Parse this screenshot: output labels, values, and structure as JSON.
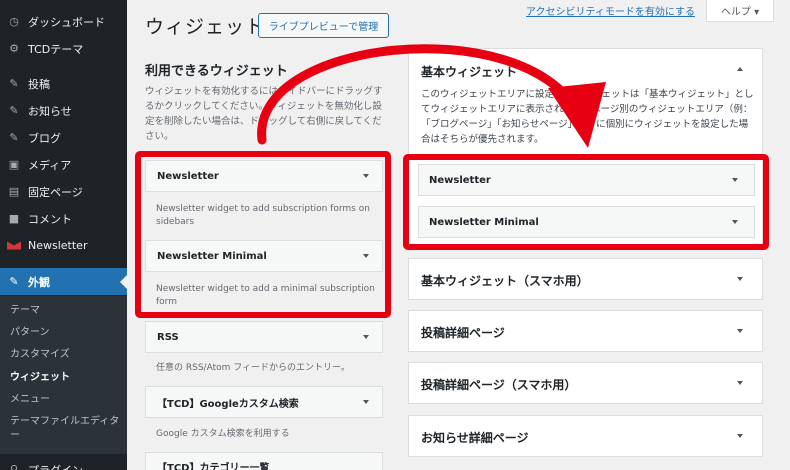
{
  "sidebar": {
    "items": [
      {
        "icon": "dashboard-icon",
        "glyph": "◷",
        "label": "ダッシュボード"
      },
      {
        "icon": "gear-icon",
        "glyph": "⚙",
        "label": "TCDテーマ"
      },
      {
        "icon": "pin-icon",
        "glyph": "✎",
        "label": "投稿"
      },
      {
        "icon": "pin-icon",
        "glyph": "✎",
        "label": "お知らせ"
      },
      {
        "icon": "pin-icon",
        "glyph": "✎",
        "label": "ブログ"
      },
      {
        "icon": "media-icon",
        "glyph": "▣",
        "label": "メディア"
      },
      {
        "icon": "page-icon",
        "glyph": "▤",
        "label": "固定ページ"
      },
      {
        "icon": "comment-icon",
        "glyph": "■",
        "label": "コメント"
      },
      {
        "icon": "newsletter-icon",
        "glyph": "",
        "label": "Newsletter"
      },
      {
        "icon": "appearance-icon",
        "glyph": "✎",
        "label": "外観"
      },
      {
        "icon": "plugin-icon",
        "glyph": "⚲",
        "label": "プラグイン"
      }
    ],
    "submenu": [
      "テーマ",
      "パターン",
      "カスタマイズ",
      "ウィジェット",
      "メニュー",
      "テーマファイルエディター"
    ]
  },
  "header": {
    "title": "ウィジェット",
    "preview_button": "ライブプレビューで管理",
    "accessibility_link": "アクセシビリティモードを有効にする",
    "help_tab": "ヘルプ ▾"
  },
  "available": {
    "title": "利用できるウィジェット",
    "description": "ウィジェットを有効化するにはサイドバーにドラッグするかクリックしてください。ウィジェットを無効化し設定を削除したい場合は、ドラッグして右側に戻してください。",
    "widgets": [
      {
        "name": "Newsletter",
        "desc": "Newsletter widget to add subscription forms on sidebars"
      },
      {
        "name": "Newsletter Minimal",
        "desc": "Newsletter widget to add a minimal subscription form"
      },
      {
        "name": "RSS",
        "desc": "任意の RSS/Atom フィードからのエントリー。"
      },
      {
        "name": "【TCD】Googleカスタム検索",
        "desc": "Google カスタム検索を利用する"
      },
      {
        "name": "【TCD】カテゴリー一覧",
        "desc": ""
      }
    ]
  },
  "areas": [
    {
      "title": "基本ウィジェット",
      "description": "このウィジェットエリアに設定したウィジェットは「基本ウィジェット」としてウィジェットエリアに表示されます。ページ別のウィジェットエリア（例：「ブログページ」「お知らせページ」等）に個別にウィジェットを設定した場合はそちらが優先されます。",
      "widgets": [
        "Newsletter",
        "Newsletter Minimal"
      ]
    },
    {
      "title": "基本ウィジェット（スマホ用）"
    },
    {
      "title": "投稿詳細ページ"
    },
    {
      "title": "投稿詳細ページ（スマホ用）"
    },
    {
      "title": "お知らせ詳細ページ"
    }
  ],
  "colors": {
    "accent": "#2271b1",
    "highlight": "#e60012",
    "sidebar_bg": "#1d2327"
  }
}
